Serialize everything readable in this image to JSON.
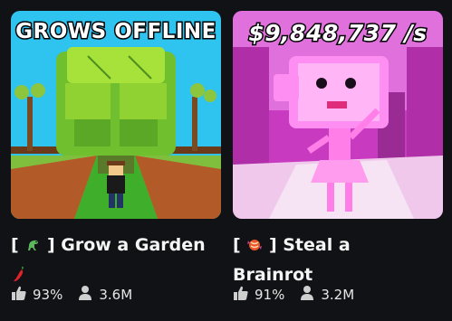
{
  "games": [
    {
      "thumbnail_caption": "GROWS OFFLINE",
      "title_prefix": "[",
      "title_emoji_icon": "dinosaur-icon",
      "title_suffix": "] Grow a Garden",
      "title_trailing_icon": "hot-pepper-icon",
      "rating": "93%",
      "players": "3.6M"
    },
    {
      "thumbnail_caption": "$9,848,737 /s",
      "title_prefix": "[",
      "title_emoji_icon": "candy-icon",
      "title_suffix": "] Steal a",
      "title_line2": "Brainrot",
      "rating": "91%",
      "players": "3.2M"
    }
  ],
  "icons": {
    "rating": "thumbs-up-icon",
    "players": "person-icon"
  },
  "colors": {
    "background": "#111216",
    "text": "#f2f2f2",
    "garden_sky": "#31c5f0",
    "brainrot_pink": "#e84fd8"
  }
}
